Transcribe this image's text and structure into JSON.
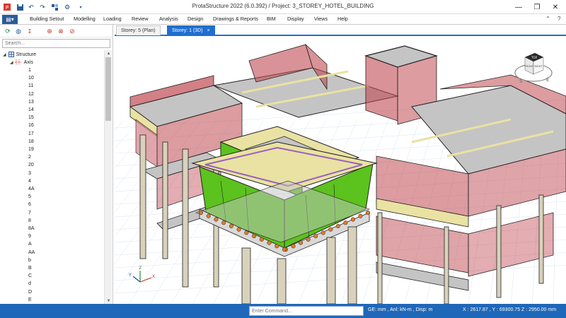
{
  "window": {
    "title": "ProtaStructure 2022 (6.0.392) / Project: 3_STOREY_HOTEL_BUILDING",
    "minimize": "—",
    "maximize": "❐",
    "close": "✕"
  },
  "quick_access": [
    "save-icon",
    "undo-icon",
    "redo-icon",
    "structure-icon",
    "settings-icon",
    "dropdown-icon"
  ],
  "menu": {
    "app_button": "▤▾",
    "items": [
      "Building Setout",
      "Modelling",
      "Loading",
      "Review",
      "Analysis",
      "Design",
      "Drawings & Reports",
      "BIM",
      "Display",
      "Views",
      "Help"
    ],
    "collapse": "⌃",
    "help": "?"
  },
  "panel": {
    "search_placeholder": "Search...",
    "tree": {
      "root": "Structure",
      "axis": "Axis",
      "axis_items": [
        "1",
        "10",
        "11",
        "12",
        "13",
        "14",
        "15",
        "16",
        "17",
        "18",
        "19",
        "2",
        "20",
        "3",
        "4",
        "4A",
        "5",
        "6",
        "7",
        "8",
        "8A",
        "9",
        "A",
        "AA",
        "b",
        "B",
        "C",
        "d",
        "D",
        "E"
      ]
    }
  },
  "tabs": [
    {
      "label": "Storey: 5 (Plan)",
      "active": false
    },
    {
      "label": "Storey: 1 (3D)",
      "active": true
    }
  ],
  "tab_close": "×",
  "viewcube": {
    "top": "TOP",
    "front": "FRONT",
    "right": "RIGHT",
    "compass_s": "S",
    "compass_e": "E"
  },
  "axes_triad": {
    "x": "X",
    "y": "Y",
    "z": "Z"
  },
  "status": {
    "command_placeholder": "Enter Command...",
    "units": "GE: mm , Anl: kN-m , Disp: m",
    "coordinates": "X : 2617.87 , Y : 69300.75   Z : 2950.00 mm"
  },
  "colors": {
    "accent": "#1f6fd0",
    "statusbar": "#1f67b8",
    "wall_red": "#c04a52",
    "core_green": "#5cc21e",
    "slab_grey": "#c4c4c4",
    "beam_yellow": "#e9e2a2",
    "purple_beam": "#9a5fc0"
  }
}
